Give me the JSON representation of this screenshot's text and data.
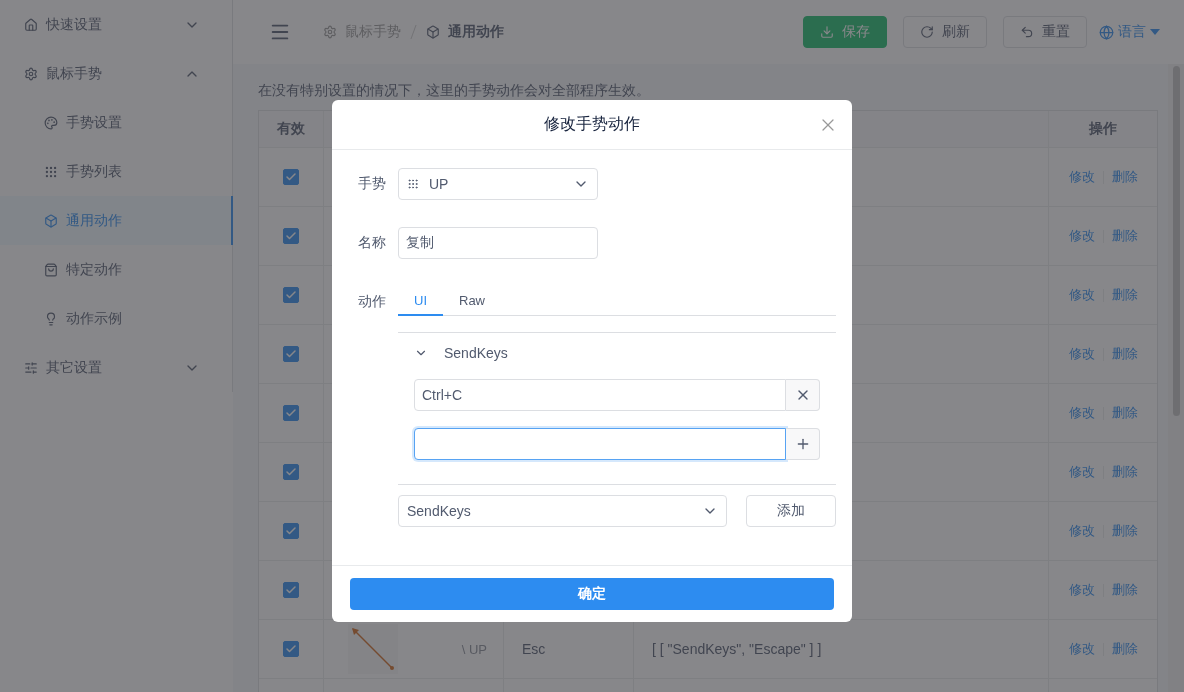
{
  "sidebar": {
    "items": [
      {
        "label": "快速设置",
        "expanded": false,
        "selected": false
      },
      {
        "label": "鼠标手势",
        "expanded": true,
        "selected": false,
        "children": [
          {
            "label": "手势设置",
            "selected": false
          },
          {
            "label": "手势列表",
            "selected": false
          },
          {
            "label": "通用动作",
            "selected": true
          },
          {
            "label": "特定动作",
            "selected": false
          },
          {
            "label": "动作示例",
            "selected": false
          }
        ]
      },
      {
        "label": "其它设置",
        "expanded": false,
        "selected": false
      }
    ]
  },
  "header": {
    "breadcrumb": [
      "鼠标手势",
      "通用动作"
    ],
    "buttons": [
      {
        "label": "保存",
        "kind": "primary"
      },
      {
        "label": "刷新",
        "kind": "default"
      },
      {
        "label": "重置",
        "kind": "default"
      }
    ],
    "language": "语言"
  },
  "notice": "在没有特别设置的情况下，这里的手势动作会对全部程序生效。",
  "table": {
    "columns": [
      {
        "label": "有效"
      },
      {
        "label": "操作"
      }
    ],
    "rows": [
      {
        "enabled": true,
        "actions": [
          "修改",
          "删除"
        ]
      },
      {
        "enabled": true,
        "actions": [
          "修改",
          "删除"
        ]
      },
      {
        "enabled": true,
        "actions": [
          "修改",
          "删除"
        ]
      },
      {
        "enabled": true,
        "actions": [
          "修改",
          "删除"
        ]
      },
      {
        "enabled": true,
        "actions": [
          "修改",
          "删除"
        ]
      },
      {
        "enabled": true,
        "actions": [
          "修改",
          "删除"
        ]
      },
      {
        "enabled": true,
        "actions": [
          "修改",
          "删除"
        ]
      },
      {
        "enabled": true,
        "actions": [
          "修改",
          "删除"
        ]
      },
      {
        "enabled": true,
        "gesture": "\\ UP",
        "column_3": "Esc",
        "column_4": "[ [ \"SendKeys\", \"Escape\" ] ]",
        "actions": [
          "修改",
          "删除"
        ]
      }
    ]
  },
  "modal": {
    "title": "修改手势动作",
    "fields": [
      {
        "label": "手势",
        "kind": "select",
        "value": "UP"
      },
      {
        "label": "名称",
        "kind": "input",
        "value": "复制"
      }
    ],
    "action_label": "动作",
    "tabs": [
      {
        "label": "UI",
        "selected": true
      },
      {
        "label": "Raw",
        "selected": false
      }
    ],
    "action": {
      "name": "SendKeys",
      "expanded": true,
      "keys": [
        {
          "kind": "remove",
          "value": "Ctrl+C",
          "focused": false
        },
        {
          "kind": "add",
          "focused": true
        }
      ]
    },
    "add_select": "SendKeys",
    "add_button": "添加",
    "confirm": "确定"
  }
}
